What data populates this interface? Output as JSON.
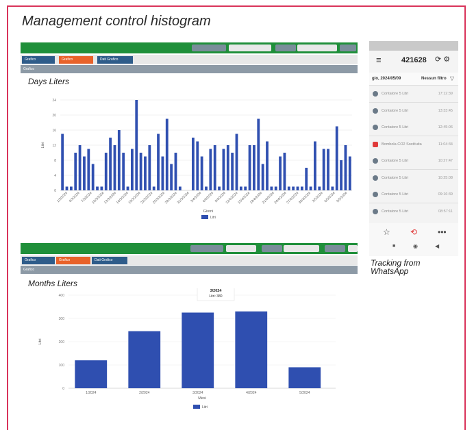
{
  "title": "Management control histogram",
  "top_panel": {
    "tabs": [
      "Grafico",
      "Grafico",
      "Dati Grafico"
    ],
    "section": "Grafico",
    "chart_title": "Days Liters"
  },
  "bottom_panel": {
    "tabs": [
      "Grafico",
      "Grafico",
      "Dati Grafico"
    ],
    "section": "Grafico",
    "chart_title": "Months Liters"
  },
  "chart_data": [
    {
      "type": "bar",
      "title": "Days Liters",
      "xlabel": "Giorni",
      "ylabel": "Litri",
      "ylim": [
        0,
        24
      ],
      "y_ticks": [
        0,
        4,
        8,
        12,
        16,
        20,
        24
      ],
      "x_tick_labels": [
        "1/3/2024",
        "4/3/2024",
        "7/3/2024",
        "10/3/2024",
        "13/3/2024",
        "16/3/2024",
        "19/3/2024",
        "22/3/2024",
        "25/3/2024",
        "28/3/2024",
        "31/3/2024",
        "3/4/2024",
        "6/4/2024",
        "9/4/2024",
        "12/4/2024",
        "15/4/2024",
        "18/4/2024",
        "21/4/2024",
        "24/4/2024",
        "27/4/2024",
        "30/4/2024",
        "3/5/2024",
        "6/5/2024",
        "9/5/2024"
      ],
      "series": [
        {
          "name": "Litri",
          "color": "#2f4fb0",
          "values": [
            15,
            1,
            1,
            10,
            12,
            9,
            11,
            7,
            1,
            1,
            10,
            14,
            12,
            16,
            10,
            1,
            11,
            25,
            10,
            9,
            12,
            1,
            15,
            9,
            19,
            7,
            10,
            1,
            0,
            0,
            14,
            13,
            9,
            1,
            11,
            12,
            1,
            11,
            12,
            10,
            15,
            1,
            1,
            12,
            12,
            19,
            7,
            13,
            1,
            1,
            9,
            10,
            1,
            1,
            1,
            1,
            6,
            1,
            13,
            1,
            11,
            11,
            1,
            17,
            8,
            12,
            9
          ]
        }
      ],
      "legend": "bottom-center"
    },
    {
      "type": "bar",
      "title": "Months Liters",
      "xlabel": "Mesi",
      "ylabel": "Litri",
      "ylim": [
        0,
        400
      ],
      "y_ticks": [
        0,
        100,
        200,
        300,
        400
      ],
      "y_tick_labels": [
        "0",
        "100",
        "200",
        "300",
        "400"
      ],
      "categories": [
        "1/2024",
        "2/2024",
        "3/2024",
        "4/2024",
        "5/2024"
      ],
      "series": [
        {
          "name": "Litri",
          "color": "#2f4fb0",
          "values": [
            120,
            245,
            325,
            330,
            90
          ]
        }
      ],
      "tooltip": {
        "title": "3/2024",
        "label": "Litri",
        "value": "380"
      },
      "legend": "bottom-center"
    }
  ],
  "phone": {
    "number": "421628",
    "date": "gio, 2024/05/09",
    "filter": "Nessun filtro",
    "rows": [
      {
        "label": "Contatore 5 Litri",
        "time": "17:12:39",
        "alert": false
      },
      {
        "label": "Contatore 5 Litri",
        "time": "13:33:45",
        "alert": false
      },
      {
        "label": "Contatore 5 Litri",
        "time": "12:45:06",
        "alert": false
      },
      {
        "label": "Bombola CO2 Sostituita",
        "time": "11:04:34",
        "alert": true
      },
      {
        "label": "Contatore 5 Litri",
        "time": "10:27:47",
        "alert": false
      },
      {
        "label": "Contatore 5 Litri",
        "time": "10:25:08",
        "alert": false
      },
      {
        "label": "Contatore 5 Litri",
        "time": "09:16:39",
        "alert": false
      },
      {
        "label": "Contatore 5 Litri",
        "time": "08:57:11",
        "alert": false
      },
      {
        "label": "Contatore 5 Litri",
        "time": "07:10:14",
        "alert": false
      }
    ]
  },
  "caption": "Tracking from WhatsApp"
}
